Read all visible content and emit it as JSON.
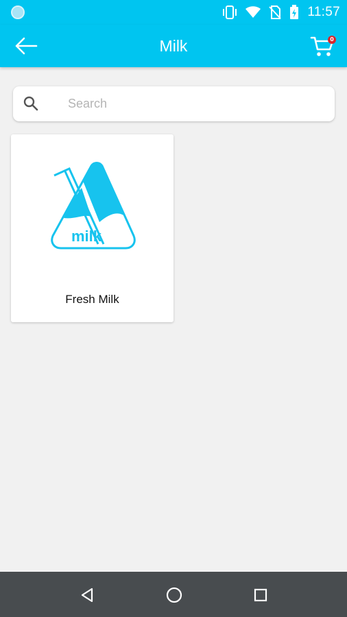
{
  "status_bar": {
    "time": "11:57",
    "icons": [
      "notification-dot-icon",
      "vibrate-icon",
      "wifi-icon",
      "no-sim-icon",
      "battery-charging-icon"
    ]
  },
  "app_bar": {
    "title": "Milk",
    "back_icon": "arrow-left-icon",
    "cart_icon": "cart-icon",
    "cart_count": "0"
  },
  "search": {
    "placeholder": "Search",
    "value": ""
  },
  "products": [
    {
      "name": "Fresh Milk",
      "logo_text": "milk",
      "image_icon": "milk-carton-logo"
    }
  ],
  "nav_bar": {
    "buttons": [
      "back-triangle-icon",
      "home-circle-icon",
      "recents-square-icon"
    ]
  },
  "colors": {
    "primary": "#00c5f0",
    "background": "#f1f1f1",
    "badge": "#d9262c",
    "nav_bar": "#484c4f"
  }
}
